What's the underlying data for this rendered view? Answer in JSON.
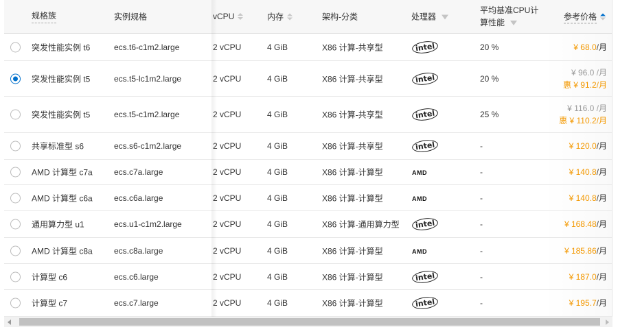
{
  "headers": {
    "family": "规格族",
    "spec": "实例规格",
    "vcpu": "vCPU",
    "memory": "内存",
    "arch": "架构-分类",
    "processor": "处理器",
    "perf_line1": "平均基准CPU计",
    "perf_line2": "算性能",
    "price": "参考价格"
  },
  "rows": [
    {
      "selected": false,
      "family": "突发性能实例 t6",
      "spec": "ecs.t6-c1m2.large",
      "vcpu": "2 vCPU",
      "memory": "4 GiB",
      "arch": "X86 计算-共享型",
      "processor": "intel",
      "perf": "20 %",
      "price": "¥ 68.0",
      "unit": "/月",
      "orig_price": null
    },
    {
      "selected": true,
      "family": "突发性能实例 t5",
      "spec": "ecs.t5-lc1m2.large",
      "vcpu": "2 vCPU",
      "memory": "4 GiB",
      "arch": "X86 计算-共享型",
      "processor": "intel",
      "perf": "20 %",
      "orig_price": "¥ 96.0 /月",
      "price": "惠 ¥ 91.2",
      "unit": "/月"
    },
    {
      "selected": false,
      "family": "突发性能实例 t5",
      "spec": "ecs.t5-c1m2.large",
      "vcpu": "2 vCPU",
      "memory": "4 GiB",
      "arch": "X86 计算-共享型",
      "processor": "intel",
      "perf": "25 %",
      "orig_price": "¥ 116.0 /月",
      "price": "惠 ¥ 110.2",
      "unit": "/月"
    },
    {
      "selected": false,
      "family": "共享标准型 s6",
      "spec": "ecs.s6-c1m2.large",
      "vcpu": "2 vCPU",
      "memory": "4 GiB",
      "arch": "X86 计算-共享型",
      "processor": "intel",
      "perf": "-",
      "price": "¥ 120.0",
      "unit": "/月",
      "orig_price": null
    },
    {
      "selected": false,
      "family": "AMD 计算型 c7a",
      "spec": "ecs.c7a.large",
      "vcpu": "2 vCPU",
      "memory": "4 GiB",
      "arch": "X86 计算-计算型",
      "processor": "AMD",
      "perf": "-",
      "price": "¥ 140.8",
      "unit": "/月",
      "orig_price": null
    },
    {
      "selected": false,
      "family": "AMD 计算型 c6a",
      "spec": "ecs.c6a.large",
      "vcpu": "2 vCPU",
      "memory": "4 GiB",
      "arch": "X86 计算-计算型",
      "processor": "AMD",
      "perf": "-",
      "price": "¥ 140.8",
      "unit": "/月",
      "orig_price": null
    },
    {
      "selected": false,
      "family": "通用算力型 u1",
      "spec": "ecs.u1-c1m2.large",
      "vcpu": "2 vCPU",
      "memory": "4 GiB",
      "arch": "X86 计算-通用算力型",
      "processor": "intel",
      "perf": "-",
      "price": "¥ 168.48",
      "unit": "/月",
      "orig_price": null
    },
    {
      "selected": false,
      "family": "AMD 计算型 c8a",
      "spec": "ecs.c8a.large",
      "vcpu": "2 vCPU",
      "memory": "4 GiB",
      "arch": "X86 计算-计算型",
      "processor": "AMD",
      "perf": "-",
      "price": "¥ 185.86",
      "unit": "/月",
      "orig_price": null
    },
    {
      "selected": false,
      "family": "计算型 c6",
      "spec": "ecs.c6.large",
      "vcpu": "2 vCPU",
      "memory": "4 GiB",
      "arch": "X86 计算-计算型",
      "processor": "intel",
      "perf": "-",
      "price": "¥ 187.0",
      "unit": "/月",
      "orig_price": null
    },
    {
      "selected": false,
      "family": "计算型 c7",
      "spec": "ecs.c7.large",
      "vcpu": "2 vCPU",
      "memory": "4 GiB",
      "arch": "X86 计算-计算型",
      "processor": "intel",
      "perf": "-",
      "price": "¥ 195.7",
      "unit": "/月",
      "orig_price": null
    }
  ],
  "colors": {
    "accent": "#0070cc",
    "price": "#f39800"
  }
}
